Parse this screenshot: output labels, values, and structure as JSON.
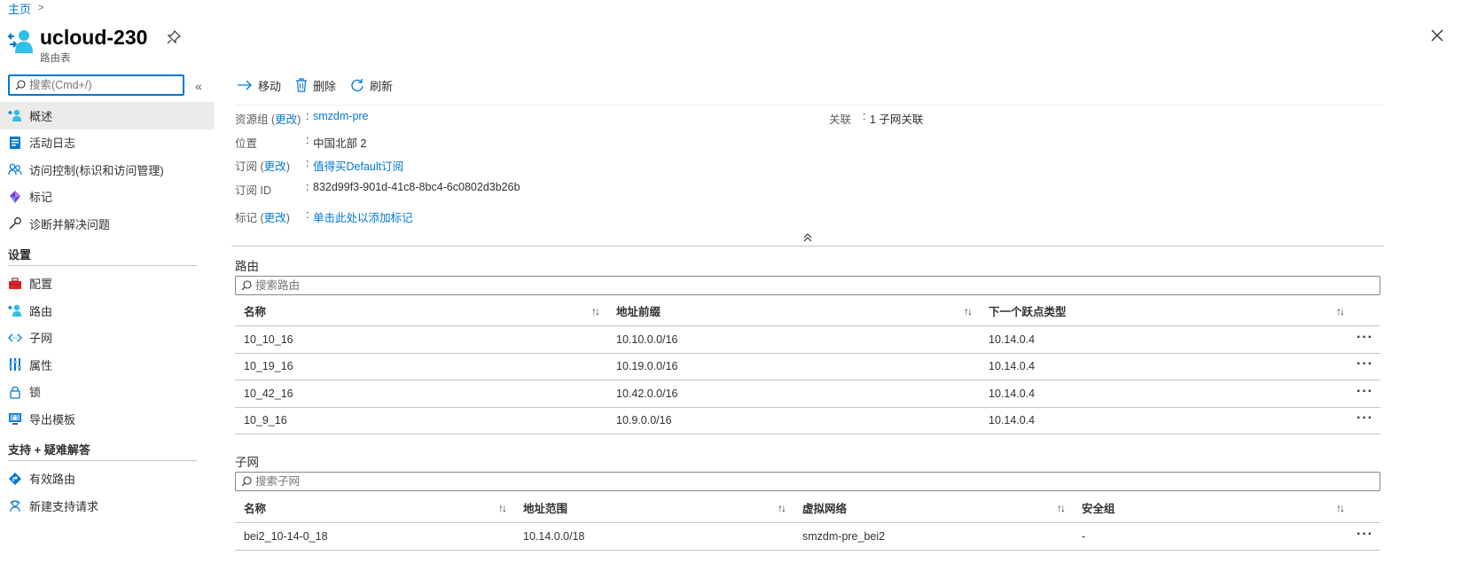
{
  "breadcrumb": {
    "home": "主页",
    "separator": ">"
  },
  "header": {
    "title": "ucloud-230",
    "subtitle": "路由表"
  },
  "sidebar": {
    "search_placeholder": "搜索(Cmd+/)",
    "collapse_glyph": "«",
    "items_top": [
      {
        "label": "概述",
        "icon": "overview-icon"
      },
      {
        "label": "活动日志",
        "icon": "activity-log-icon"
      },
      {
        "label": "访问控制(标识和访问管理)",
        "icon": "access-control-icon"
      },
      {
        "label": "标记",
        "icon": "tag-icon"
      },
      {
        "label": "诊断并解决问题",
        "icon": "wrench-icon"
      }
    ],
    "settings_heading": "设置",
    "items_settings": [
      {
        "label": "配置",
        "icon": "toolbox-icon"
      },
      {
        "label": "路由",
        "icon": "route-icon"
      },
      {
        "label": "子网",
        "icon": "subnet-icon"
      },
      {
        "label": "属性",
        "icon": "properties-icon"
      },
      {
        "label": "锁",
        "icon": "lock-icon"
      },
      {
        "label": "导出模板",
        "icon": "export-template-icon"
      }
    ],
    "support_heading": "支持 + 疑难解答",
    "items_support": [
      {
        "label": "有效路由",
        "icon": "effective-routes-icon"
      },
      {
        "label": "新建支持请求",
        "icon": "support-request-icon"
      }
    ]
  },
  "toolbar": {
    "move": "移动",
    "delete": "删除",
    "refresh": "刷新"
  },
  "essentials": {
    "resource_group_label": "资源组",
    "change": "更改",
    "resource_group_value": "smzdm-pre",
    "location_label": "位置",
    "location_value": "中国北部 2",
    "subscription_label": "订阅",
    "subscription_value": "值得买Default订阅",
    "subscription_id_label": "订阅 ID",
    "subscription_id_value": "832d99f3-901d-41c8-8bc4-6c0802d3b26b",
    "tags_label": "标记",
    "tags_value": "单击此处以添加标记",
    "association_label": "关联",
    "association_value": "1 子网关联"
  },
  "routes": {
    "title": "路由",
    "search_placeholder": "搜索路由",
    "columns": [
      "名称",
      "地址前缀",
      "下一个跃点类型"
    ],
    "rows": [
      [
        "10_10_16",
        "10.10.0.0/16",
        "10.14.0.4"
      ],
      [
        "10_19_16",
        "10.19.0.0/16",
        "10.14.0.4"
      ],
      [
        "10_42_16",
        "10.42.0.0/16",
        "10.14.0.4"
      ],
      [
        "10_9_16",
        "10.9.0.0/16",
        "10.14.0.4"
      ]
    ]
  },
  "subnets": {
    "title": "子网",
    "search_placeholder": "搜索子网",
    "columns": [
      "名称",
      "地址范围",
      "虚拟网络",
      "安全组"
    ],
    "rows": [
      [
        "bei2_10-14-0_18",
        "10.14.0.0/18",
        "smzdm-pre_bei2",
        "-"
      ]
    ]
  },
  "glyphs": {
    "sort": "↑↓",
    "more": "···",
    "paren_open": "(",
    "paren_close": ")",
    "colon": ":"
  },
  "colors": {
    "accent": "#0078d4",
    "text": "#323130",
    "muted": "#605e5c",
    "active_bg": "#edebe9"
  }
}
